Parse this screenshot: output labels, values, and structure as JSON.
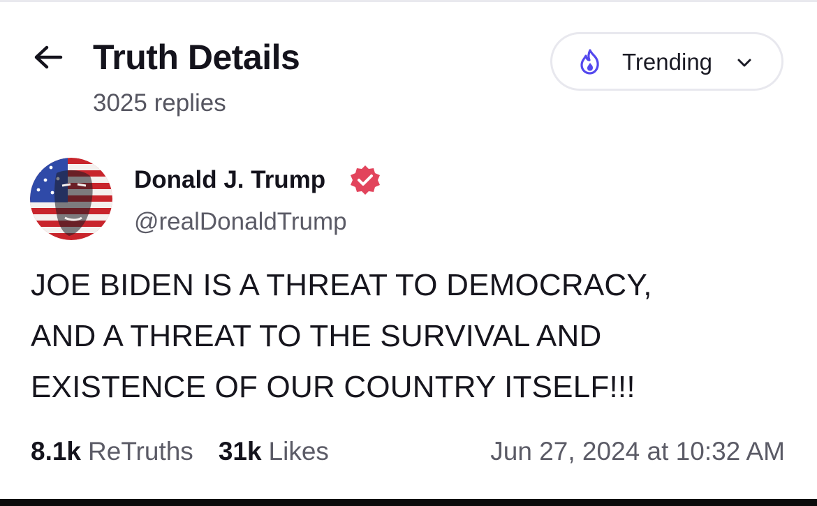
{
  "header": {
    "title": "Truth Details",
    "subtitle": "3025 replies",
    "back_icon": "arrow-left-icon",
    "sort": {
      "label": "Trending",
      "icon": "flame-icon",
      "chevron_icon": "chevron-down-icon"
    }
  },
  "post": {
    "author": {
      "name": "Donald J. Trump",
      "handle": "@realDonaldTrump",
      "verified_icon": "verified-badge-icon",
      "verified_color": "#e2445c"
    },
    "lines": [
      "JOE BIDEN IS A THREAT TO DEMOCRACY,",
      "AND A THREAT TO THE SURVIVAL AND",
      "EXISTENCE OF OUR COUNTRY ITSELF!!!"
    ],
    "stats": {
      "retruths_count": "8.1k",
      "retruths_label": "ReTruths",
      "likes_count": "31k",
      "likes_label": "Likes"
    },
    "timestamp": "Jun 27, 2024 at 10:32 AM"
  },
  "colors": {
    "accent": "#5448ee",
    "verified": "#e2445c",
    "text_primary": "#14131c",
    "text_secondary": "#5b5b66"
  }
}
